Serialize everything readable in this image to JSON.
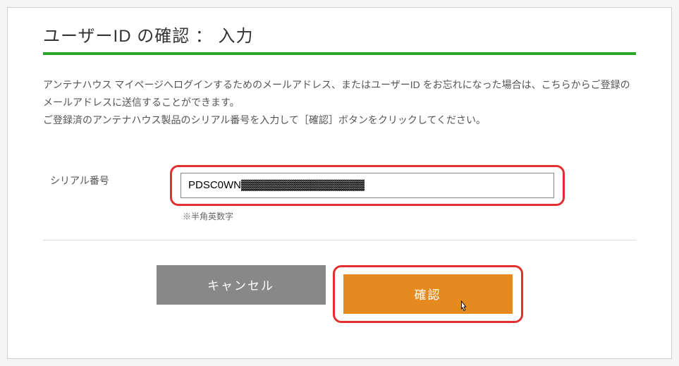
{
  "page": {
    "title": "ユーザーID の確認 ： 入力"
  },
  "description": {
    "line1": "アンテナハウス マイページへログインするためのメールアドレス、またはユーザーID をお忘れになった場合は、こちらからご登録のメールアドレスに送信することができます。",
    "line2": "ご登録済のアンテナハウス製品のシリアル番号を入力して［確認］ボタンをクリックしてください。"
  },
  "form": {
    "serial_label": "シリアル番号",
    "serial_value": "PDSC0WN▓▓▓▓▓▓▓▓▓▓▓▓▓▓▓▓",
    "serial_hint": "※半角英数字"
  },
  "buttons": {
    "cancel": "キャンセル",
    "confirm": "確認"
  },
  "colors": {
    "accent": "#2ba82b",
    "highlight_border": "#e03030",
    "confirm_bg": "#e58a1f",
    "cancel_bg": "#888888"
  }
}
